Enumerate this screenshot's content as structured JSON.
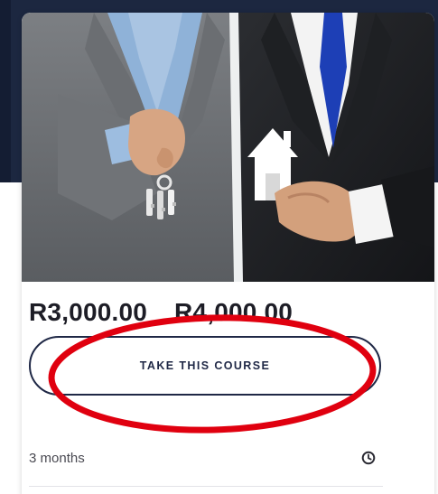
{
  "course_card": {
    "price_current": "R3,000.00",
    "price_original": "R4,000.00",
    "cta_label": "TAKE THIS COURSE",
    "duration": "3 months",
    "hero_icon": "real-estate-keys-house-photo",
    "duration_icon": "clock-icon"
  },
  "colors": {
    "backdrop": "#1c2740",
    "cta_border": "#1f2846",
    "highlight_ring": "#e0000f",
    "price_text": "#1d1d26"
  }
}
